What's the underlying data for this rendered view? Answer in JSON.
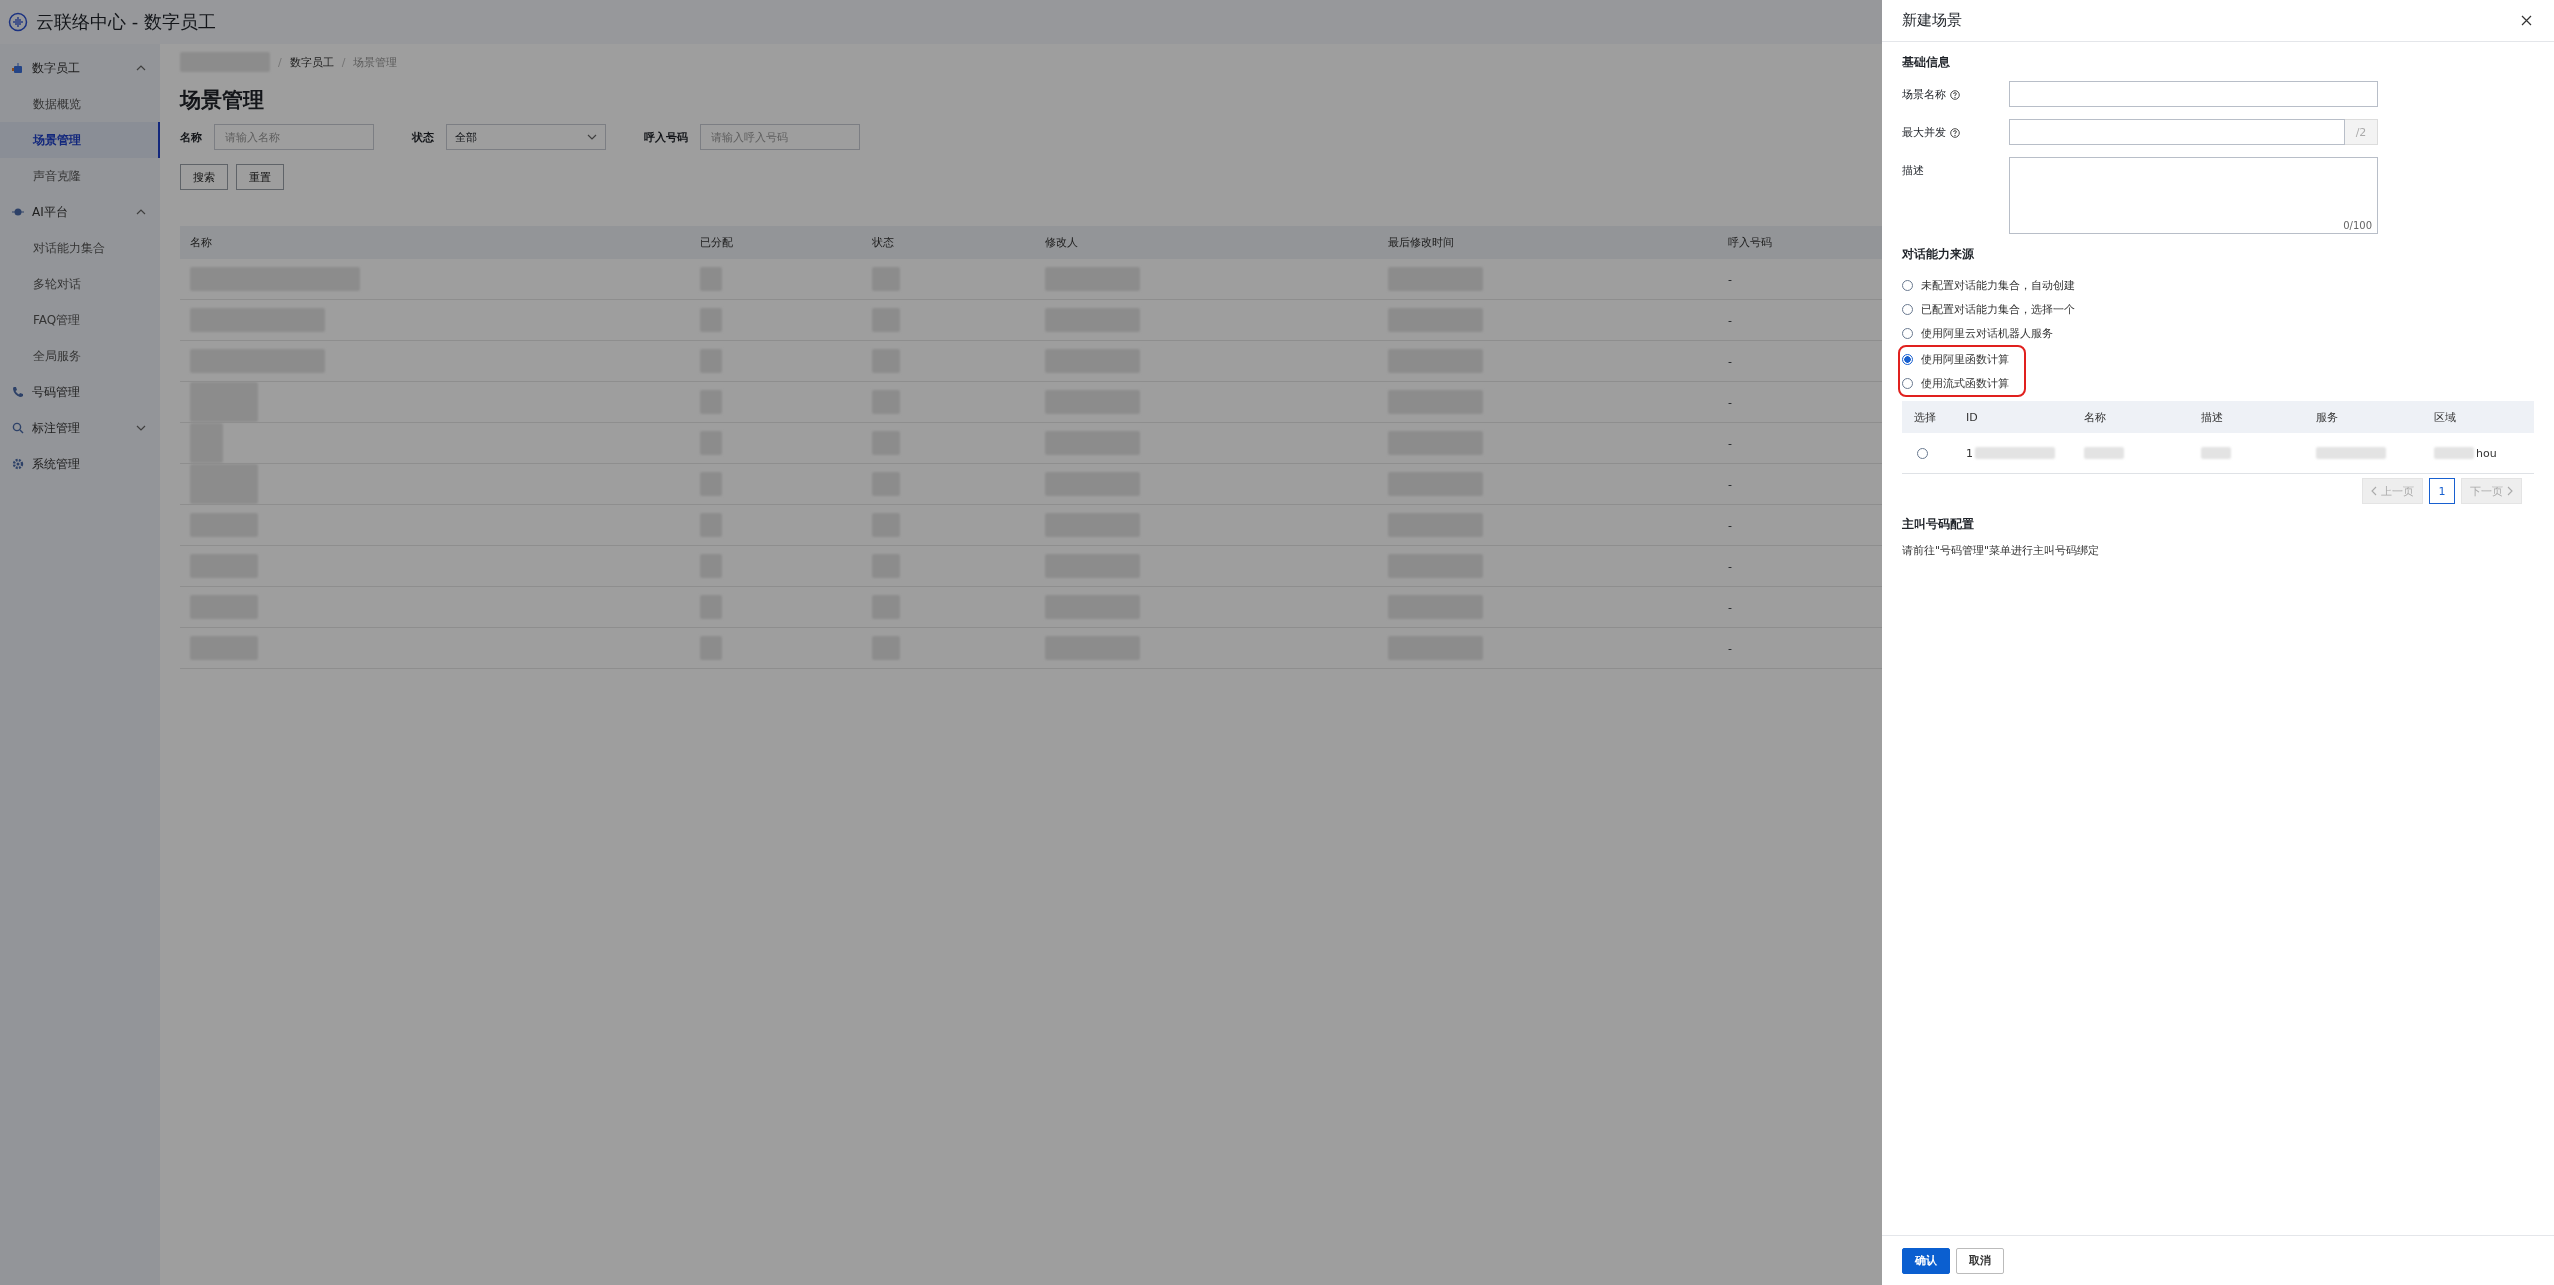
{
  "app": {
    "title": "云联络中心 - 数字员工"
  },
  "sidebar": [
    {
      "label": "数字员工",
      "expanded": true,
      "children": [
        {
          "label": "数据概览",
          "selected": false
        },
        {
          "label": "场景管理",
          "selected": true
        },
        {
          "label": "声音克隆",
          "selected": false
        }
      ]
    },
    {
      "label": "AI平台",
      "expanded": true,
      "children": [
        {
          "label": "对话能力集合",
          "selected": false
        },
        {
          "label": "多轮对话",
          "selected": false
        },
        {
          "label": "FAQ管理",
          "selected": false
        },
        {
          "label": "全局服务",
          "selected": false
        }
      ]
    },
    {
      "label": "号码管理"
    },
    {
      "label": "标注管理",
      "expanded": false
    },
    {
      "label": "系统管理"
    }
  ],
  "breadcrumb": [
    {
      "separator": "/",
      "label": "数字员工"
    },
    {
      "separator": "/",
      "label": "场景管理"
    }
  ],
  "page_title": "场景管理",
  "filters": [
    {
      "kind": "input",
      "label": "名称",
      "placeholder": "请输入名称"
    },
    {
      "kind": "select",
      "label": "状态",
      "value": "全部"
    },
    {
      "kind": "input",
      "label": "呼入号码",
      "placeholder": "请输入呼入号码"
    }
  ],
  "filter_buttons": [
    "搜索",
    "重置"
  ],
  "table": {
    "columns": [
      "名称",
      "已分配",
      "状态",
      "修改人",
      "最后修改时间",
      "呼入号码"
    ],
    "rows": [
      {
        "inbound_number": "-"
      },
      {
        "inbound_number": "-"
      },
      {
        "inbound_number": "-"
      },
      {
        "inbound_number": "-"
      },
      {
        "inbound_number": "-"
      },
      {
        "inbound_number": "-"
      },
      {
        "inbound_number": "-"
      },
      {
        "inbound_number": "-"
      },
      {
        "inbound_number": "-"
      },
      {
        "inbound_number": "-"
      }
    ]
  },
  "drawer": {
    "title": "新建场景",
    "sections": [
      {
        "title": "基础信息"
      },
      {
        "title": "对话能力来源"
      },
      {
        "title": "主叫号码配置",
        "note": "请前往\"号码管理\"菜单进行主叫号码绑定"
      }
    ],
    "fields": [
      {
        "kind": "input",
        "label": "场景名称",
        "help": true
      },
      {
        "kind": "input",
        "label": "最大并发",
        "help": true,
        "suffix": "/2"
      },
      {
        "kind": "textarea",
        "label": "描述",
        "counter": "0/100"
      }
    ],
    "sources": [
      {
        "label": "未配置对话能力集合，自动创建",
        "selected": false,
        "highlighted": false
      },
      {
        "label": "已配置对话能力集合，选择一个",
        "selected": false,
        "highlighted": false
      },
      {
        "label": "使用阿里云对话机器人服务",
        "selected": false,
        "highlighted": false
      },
      {
        "label": "使用阿里函数计算",
        "selected": true,
        "highlighted": true
      },
      {
        "label": "使用流式函数计算",
        "selected": false,
        "highlighted": true
      }
    ],
    "function_table": {
      "columns": [
        "选择",
        "ID",
        "名称",
        "描述",
        "服务",
        "区域"
      ],
      "rows": [
        {
          "selected": false,
          "id": "1",
          "region": "hou"
        }
      ]
    },
    "pagination": {
      "prev": {
        "label": "上一页",
        "disabled": true
      },
      "pages": [
        {
          "label": "1",
          "selected": true
        }
      ],
      "next": {
        "label": "下一页",
        "disabled": true
      }
    },
    "buttons": [
      {
        "label": "确认",
        "kind": "primary"
      },
      {
        "label": "取消",
        "kind": "default"
      }
    ]
  }
}
